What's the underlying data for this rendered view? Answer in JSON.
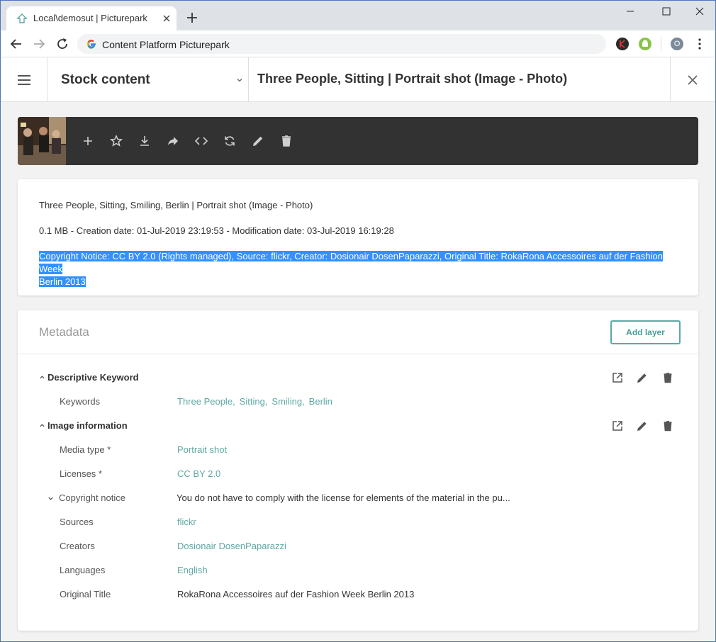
{
  "browser": {
    "tab_title": "Local\\demosut | Picturepark",
    "omnibox_text": "Content Platform Picturepark",
    "profile_initial": "O"
  },
  "header": {
    "channel": "Stock content",
    "title": "Three People, Sitting | Portrait shot (Image - Photo)"
  },
  "info": {
    "line1": "Three People, Sitting, Smiling, Berlin | Portrait shot (Image - Photo)",
    "line2": "0.1 MB - Creation date: 01-Jul-2019 23:19:53 - Modification date: 03-Jul-2019 16:19:28",
    "copyright_line1": "Copyright Notice: CC BY 2.0 (Rights managed), Source: flickr, Creator: Dosionair DosenPaparazzi, Original Title: RokaRona Accessoires auf der Fashion Week",
    "copyright_line2": "Berlin 2013"
  },
  "metadata": {
    "title": "Metadata",
    "add_layer_label": "Add layer",
    "sections": [
      {
        "title": "Descriptive Keyword",
        "fields": [
          {
            "label": "Keywords",
            "values": [
              "Three People,",
              "Sitting,",
              "Smiling,",
              "Berlin"
            ]
          }
        ]
      },
      {
        "title": "Image information",
        "fields": [
          {
            "label": "Media type *",
            "value": "Portrait shot"
          },
          {
            "label": "Licenses *",
            "value": "CC BY 2.0"
          },
          {
            "label": "Copyright notice",
            "value": "You do not have to comply with the license for elements of the material in the pu..."
          },
          {
            "label": "Sources",
            "value": "flickr"
          },
          {
            "label": "Creators",
            "value": "Dosionair DosenPaparazzi"
          },
          {
            "label": "Languages",
            "value": "English"
          },
          {
            "label": "Original Title",
            "value": "RokaRona Accessoires auf der Fashion Week Berlin 2013"
          }
        ]
      }
    ]
  },
  "colors": {
    "accent": "#5fa8a3",
    "selection": "#3390ff",
    "action_bar": "#323232"
  },
  "icons": {
    "actions": [
      "add-icon",
      "star-icon",
      "download-icon",
      "share-icon",
      "embed-code-icon",
      "refresh-icon",
      "edit-icon",
      "delete-icon"
    ],
    "section_tools": [
      "open-external-icon",
      "edit-icon",
      "delete-icon"
    ]
  }
}
